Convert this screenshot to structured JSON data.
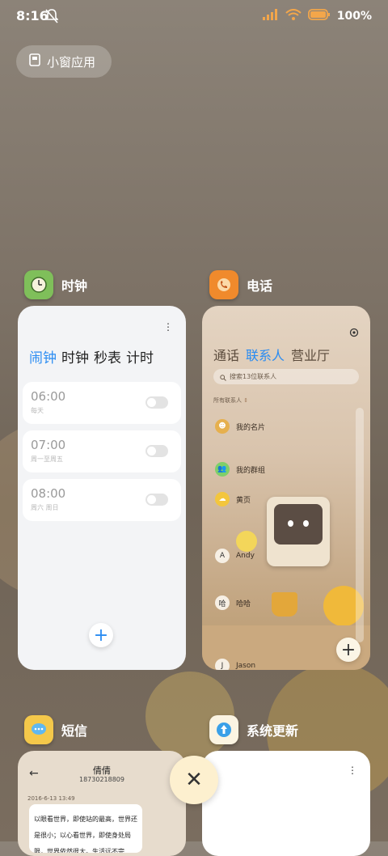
{
  "status_bar": {
    "time": "8:16",
    "battery_text": "100%",
    "battery_level": 1.0
  },
  "floating_window_button": {
    "label": "小窗应用"
  },
  "apps": {
    "clock": {
      "name": "时钟",
      "tabs": [
        "闹钟",
        "计时",
        "秒表",
        "计时"
      ],
      "tab_labels": {
        "alarm": "闹钟",
        "clock": "时钟",
        "stopwatch": "秒表",
        "timer": "计时"
      },
      "alarms": [
        {
          "time": "06:00",
          "repeat": "每天"
        },
        {
          "time": "07:00",
          "repeat": "周一至周五"
        },
        {
          "time": "08:00",
          "repeat": "周六 周日"
        }
      ],
      "add_symbol": "+"
    },
    "contacts": {
      "name": "电话",
      "tabs": {
        "calls": "通话",
        "contacts": "联系人",
        "business": "营业厅"
      },
      "search_placeholder": "搜索13位联系人",
      "all_contacts_label": "所有联系人",
      "rows": [
        {
          "name": "我的名片",
          "avatar": ""
        },
        {
          "name": "我的群组",
          "avatar": ""
        },
        {
          "name": "黄页",
          "avatar": ""
        },
        {
          "name": "Andy",
          "avatar": "A"
        },
        {
          "name": "哈哈",
          "avatar": "哈"
        },
        {
          "name": "Jason",
          "avatar": "J"
        }
      ],
      "add_symbol": "+"
    },
    "sms": {
      "name": "短信",
      "contact_name": "倩倩",
      "contact_number": "18730218809",
      "timestamp": "2016-6-13 13:49",
      "message": "以眼看世界，即使站的最高，世界还是很小；以心看世界，即使身处局限，世界依然很大。生活远不完"
    },
    "update": {
      "name": "系统更新"
    }
  },
  "close_symbol": "✕",
  "colors": {
    "accent": "#2a8cf2",
    "clock_icon": "#7fbf5a",
    "phone_icon": "#f08a2c",
    "sms_icon": "#f4c84a",
    "update_icon": "#3aa0e8"
  }
}
